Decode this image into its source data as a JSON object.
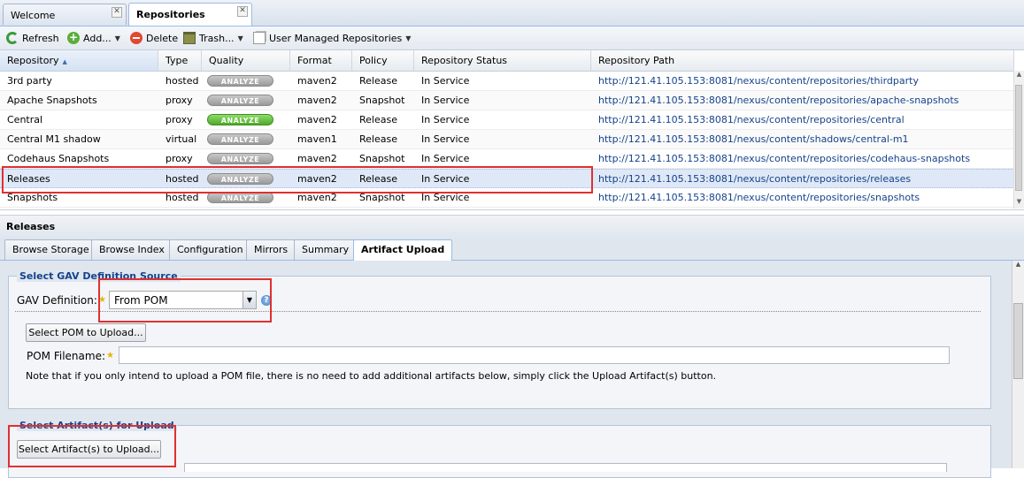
{
  "top_tabs": [
    {
      "label": "Welcome",
      "close": "✕"
    },
    {
      "label": "Repositories",
      "close": "✕"
    }
  ],
  "toolbar": {
    "refresh": "Refresh",
    "add": "Add...",
    "delete": "Delete",
    "trash": "Trash...",
    "user_managed": "User Managed Repositories"
  },
  "grid": {
    "headers": [
      "Repository",
      "Type",
      "Quality",
      "Format",
      "Policy",
      "Repository Status",
      "Repository Path"
    ],
    "analyze_label": "ANALYZE",
    "rows": [
      {
        "name": "3rd party",
        "type": "hosted",
        "quality": "gray",
        "format": "maven2",
        "policy": "Release",
        "status": "In Service",
        "path": "http://121.41.105.153:8081/nexus/content/repositories/thirdparty"
      },
      {
        "name": "Apache Snapshots",
        "type": "proxy",
        "quality": "gray",
        "format": "maven2",
        "policy": "Snapshot",
        "status": "In Service",
        "path": "http://121.41.105.153:8081/nexus/content/repositories/apache-snapshots"
      },
      {
        "name": "Central",
        "type": "proxy",
        "quality": "green",
        "format": "maven2",
        "policy": "Release",
        "status": "In Service",
        "path": "http://121.41.105.153:8081/nexus/content/repositories/central"
      },
      {
        "name": "Central M1 shadow",
        "type": "virtual",
        "quality": "gray",
        "format": "maven1",
        "policy": "Release",
        "status": "In Service",
        "path": "http://121.41.105.153:8081/nexus/content/shadows/central-m1"
      },
      {
        "name": "Codehaus Snapshots",
        "type": "proxy",
        "quality": "gray",
        "format": "maven2",
        "policy": "Snapshot",
        "status": "In Service",
        "path": "http://121.41.105.153:8081/nexus/content/repositories/codehaus-snapshots"
      },
      {
        "name": "Releases",
        "type": "hosted",
        "quality": "gray",
        "format": "maven2",
        "policy": "Release",
        "status": "In Service",
        "path": "http://121.41.105.153:8081/nexus/content/repositories/releases"
      },
      {
        "name": "Snapshots",
        "type": "hosted",
        "quality": "gray",
        "format": "maven2",
        "policy": "Snapshot",
        "status": "In Service",
        "path": "http://121.41.105.153:8081/nexus/content/repositories/snapshots"
      }
    ],
    "selected_index": 5
  },
  "detail": {
    "title": "Releases",
    "tabs": [
      "Browse Storage",
      "Browse Index",
      "Configuration",
      "Mirrors",
      "Summary",
      "Artifact Upload"
    ],
    "active_tab": "Artifact Upload",
    "gav_section": {
      "legend": "Select GAV Definition Source",
      "gav_label": "GAV Definition:",
      "gav_value": "From POM",
      "select_pom_button": "Select POM to Upload...",
      "pom_filename_label": "POM Filename:",
      "pom_filename_value": "",
      "note": "Note that if you only intend to upload a POM file, there is no need to add additional artifacts below, simply click the Upload Artifact(s) button."
    },
    "artifact_section": {
      "legend": "Select Artifact(s) for Upload",
      "select_artifacts_button": "Select Artifact(s) to Upload..."
    }
  }
}
